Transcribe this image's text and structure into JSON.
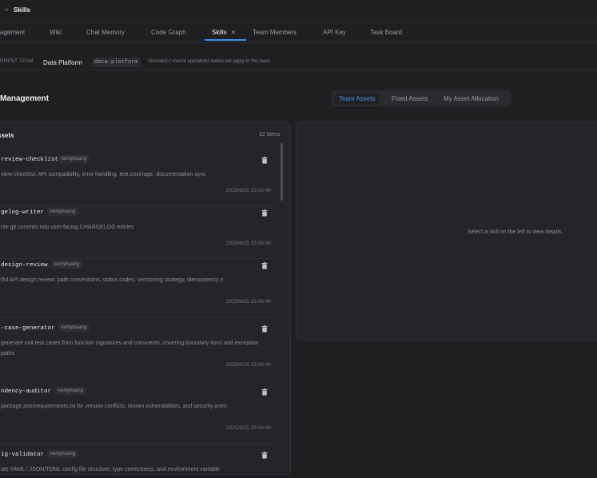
{
  "breadcrumb": {
    "separator": ">",
    "current": "Skills"
  },
  "tabs": [
    {
      "label": "agement"
    },
    {
      "label": "Wiki"
    },
    {
      "label": "Chat Memory"
    },
    {
      "label": "Code Graph"
    },
    {
      "label": "Skills",
      "close": "×"
    },
    {
      "label": "Team Members"
    },
    {
      "label": "API Key"
    },
    {
      "label": "Task Board"
    }
  ],
  "team_bar": {
    "label": "RRENT TEAM",
    "team_name": "Data Platform",
    "team_code": "data-platform",
    "note": "Allocation / mount operations below will apply to this team"
  },
  "section": {
    "title": "Management"
  },
  "segments": [
    {
      "label": "Team Assets",
      "active": true
    },
    {
      "label": "Fixed Assets",
      "active": false
    },
    {
      "label": "My Asset Allocation",
      "active": false
    }
  ],
  "assets": {
    "title": "ssets",
    "count": "32 items",
    "items": [
      {
        "name": "review-checklist",
        "author": "kentyhuang",
        "desc": "view checklist: API compatibility, error handling, test coverage, documentation sync",
        "time": "2025/6/15 23:06:40",
        "icon": "trash-icon"
      },
      {
        "name": "gelog-writer",
        "author": "kentyhuang",
        "desc": "rite git commits into user-facing CHANGELOG entries",
        "time": "2025/6/15 23:06:40",
        "icon": "trash-icon"
      },
      {
        "name": "design-review",
        "author": "kentyhuang",
        "desc": "tful API design review: path conventions, status codes, versioning strategy, idempotency n",
        "time": "2025/6/15 23:06:40",
        "icon": "trash-icon"
      },
      {
        "name": "-case-generator",
        "author": "kentyhuang",
        "desc": "generate unit test cases from function signatures and comments, covering boundary tions and exception paths",
        "time": "2025/6/15 23:06:40",
        "icon": "trash-icon"
      },
      {
        "name": "ndency-auditor",
        "author": "kentyhuang",
        "desc": "package.json/requirements.txt for version conflicts, known vulnerabilities, and security ories",
        "time": "2025/6/15 23:06:40",
        "icon": "trash-icon"
      },
      {
        "name": "ig-validator",
        "author": "kentyhuang",
        "desc": "ate YAML / JSON/TOML config file structure, type correctness, and environment variable",
        "time": "",
        "icon": "trash-icon"
      }
    ]
  },
  "detail": {
    "empty_text": "Select a skill on the left to view details."
  },
  "colors": {
    "accent": "#3f8cf0",
    "background": "#1e1f21",
    "panel": "#242528"
  }
}
